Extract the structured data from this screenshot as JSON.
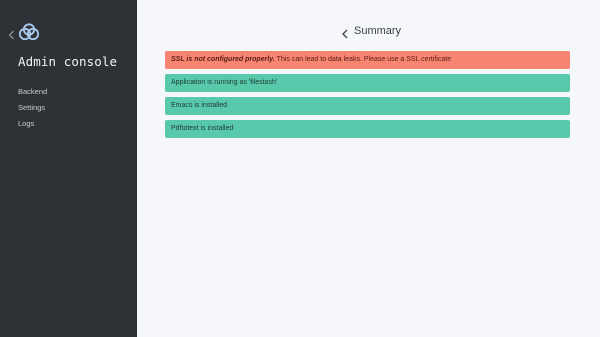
{
  "sidebar": {
    "back_icon": "chevron-left-icon",
    "logo_icon": "cloud-logo-icon",
    "title": "Admin console",
    "items": [
      {
        "label": "Backend"
      },
      {
        "label": "Settings"
      },
      {
        "label": "Logs"
      }
    ]
  },
  "header": {
    "icon": "chevron-left-icon",
    "title": "Summary"
  },
  "alerts": [
    {
      "status": "error",
      "emphasis": "SSL is not configured properly.",
      "text": " This can lead to data leaks. Please use a SSL certificate"
    },
    {
      "status": "success",
      "text": "Application is running as 'filestash'"
    },
    {
      "status": "success",
      "text": "Emacs is installed"
    },
    {
      "status": "success",
      "text": "Pdftotext is installed"
    }
  ],
  "colors": {
    "sidebar_bg": "#2e3237",
    "main_bg": "#f6f7fa",
    "error": "#f88472",
    "success": "#58c9aa"
  }
}
